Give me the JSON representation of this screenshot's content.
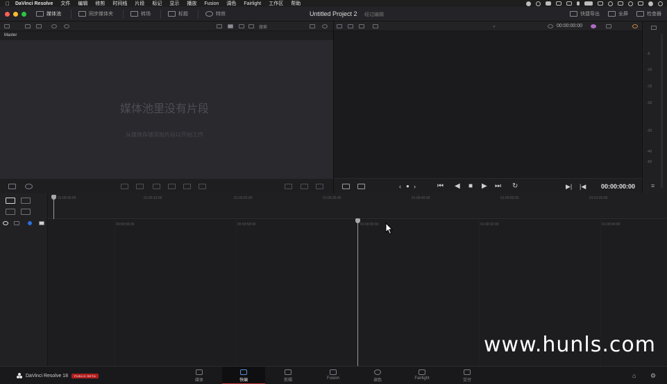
{
  "menubar": {
    "app_name": "DaVinci Resolve",
    "items": [
      "文件",
      "编辑",
      "修剪",
      "时间线",
      "片段",
      "标记",
      "显示",
      "播放",
      "Fusion",
      "调色",
      "Fairlight",
      "工作区",
      "帮助"
    ]
  },
  "toolbar": {
    "media_pool": "媒体池",
    "sync_bin": "同步媒体夹",
    "transitions": "转场",
    "titles": "标题",
    "effects": "特效",
    "project_title": "Untitled Project 2",
    "project_status": "经过编辑",
    "quick_export": "快捷导出",
    "fullscreen": "全屏",
    "inspector": "检查器"
  },
  "media_pool": {
    "bin_name": "Master",
    "search_label": "搜索",
    "empty_title": "媒体池里没有片段",
    "empty_hint": "从媒体存储添加片段以开始工作"
  },
  "viewer": {
    "top_timecode": "00:00:00:00",
    "timecode": "00:00:00:00"
  },
  "audio_meter": {
    "ticks": [
      "-5",
      "-10",
      "-15",
      "-20",
      "-30",
      "-40",
      "-50"
    ]
  },
  "timeline": {
    "upper_ruler": [
      "01:00:00:00",
      "01:00:10:00",
      "01:00:20:00",
      "01:00:30:00",
      "01:00:40:00",
      "01:00:50:00",
      "01:01:00:00"
    ],
    "lower_ruler": [
      "00:59:56:00",
      "00:59:58:00",
      "01:00:00:00",
      "01:00:02:00",
      "01:00:04:00"
    ]
  },
  "watermark": "www.hunls.com",
  "pagebar": {
    "brand": "DaVinci Resolve 18",
    "badge": "PUBLIC BETA",
    "pages": [
      "媒体",
      "快编",
      "剪辑",
      "Fusion",
      "调色",
      "Fairlight",
      "交付"
    ],
    "active_page": "快编"
  },
  "colors": {
    "accent_red": "#c23434",
    "badge_red": "#b01e1e",
    "active_blue": "#5c8fd6"
  }
}
